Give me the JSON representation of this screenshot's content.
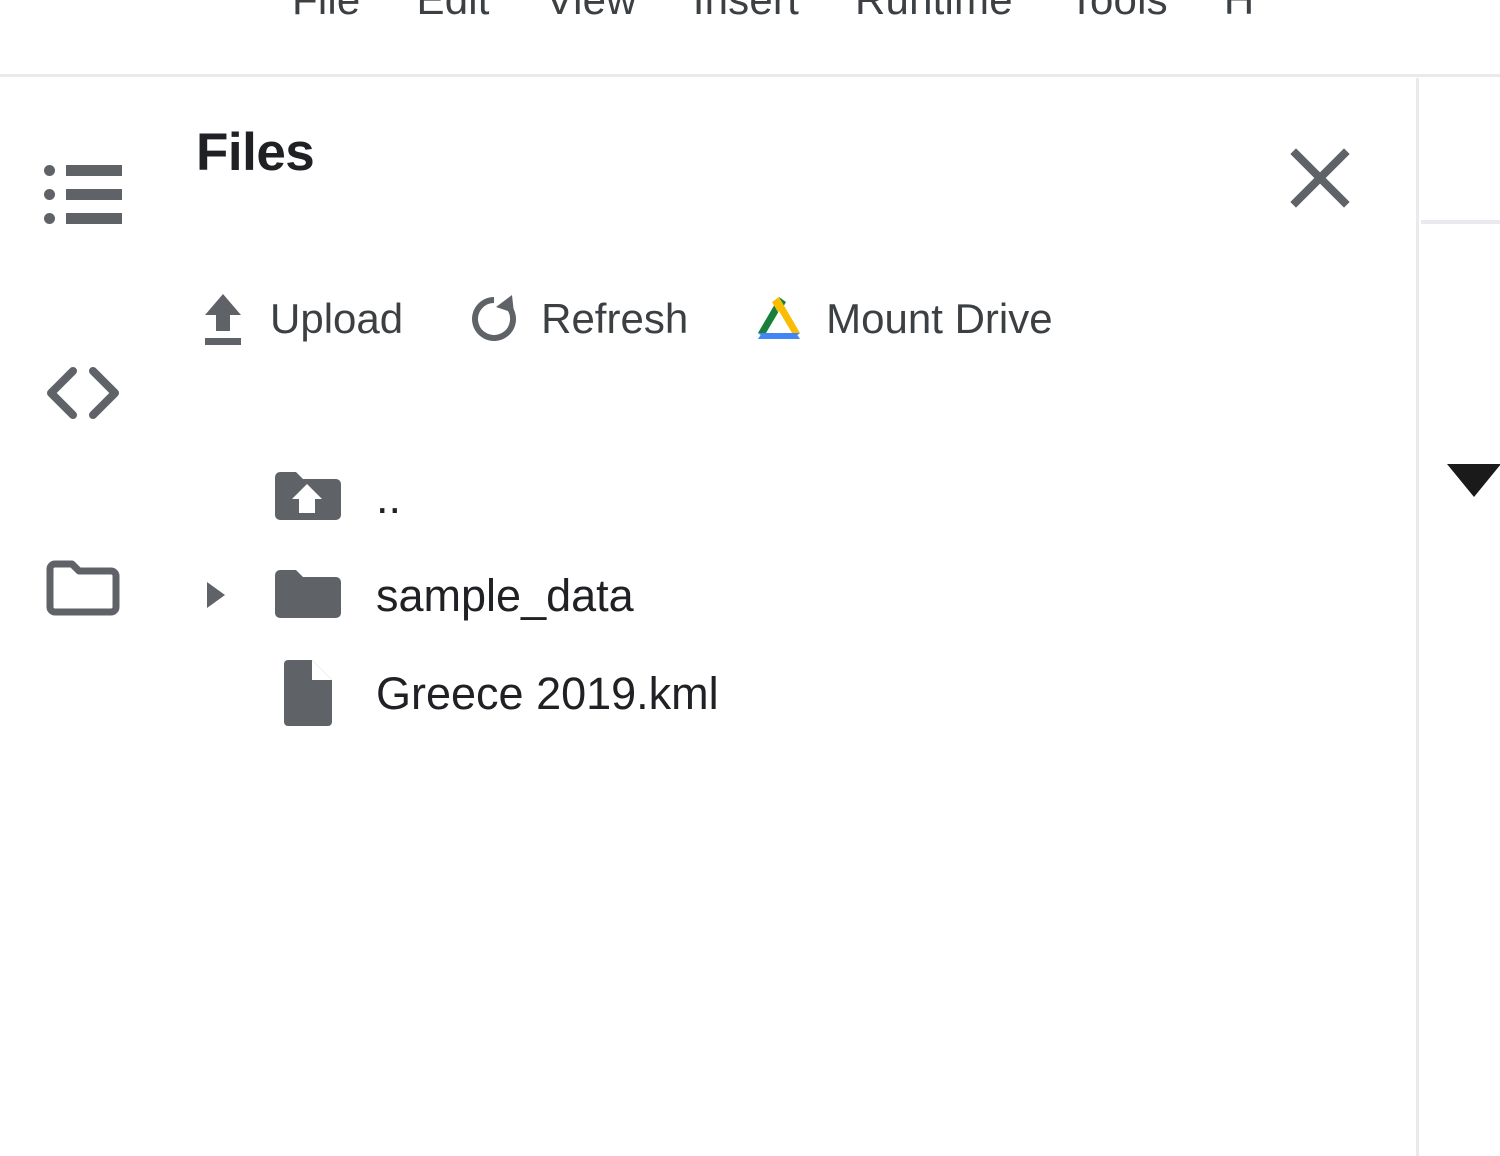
{
  "menubar": {
    "items": [
      {
        "label": "File"
      },
      {
        "label": "Edit"
      },
      {
        "label": "View"
      },
      {
        "label": "Insert"
      },
      {
        "label": "Runtime"
      },
      {
        "label": "Tools"
      },
      {
        "label": "H"
      }
    ]
  },
  "icon_rail": {
    "items": [
      {
        "name": "table-of-contents-icon",
        "icon": "list-icon"
      },
      {
        "name": "code-snippets-icon",
        "icon": "code-brackets-icon"
      },
      {
        "name": "files-icon",
        "icon": "folder-outline-icon"
      }
    ]
  },
  "panel": {
    "title": "Files",
    "close_icon": "close-icon"
  },
  "toolbar": {
    "buttons": [
      {
        "label": "Upload",
        "icon": "upload-icon"
      },
      {
        "label": "Refresh",
        "icon": "refresh-icon"
      },
      {
        "label": "Mount Drive",
        "icon": "google-drive-icon"
      }
    ]
  },
  "file_tree": {
    "rows": [
      {
        "label": "..",
        "icon": "parent-folder-icon",
        "expandable": false
      },
      {
        "label": "sample_data",
        "icon": "folder-icon",
        "expandable": true
      },
      {
        "label": "Greece 2019.kml",
        "icon": "file-icon",
        "expandable": false
      }
    ]
  },
  "right_strip": {
    "caret_icon": "caret-down-icon"
  },
  "colors": {
    "icon_gray": "#5f6368",
    "text_dark": "#202124",
    "text_menu": "#3c4043",
    "divider": "#e8eaed",
    "drive_green": "#188038",
    "drive_yellow": "#fbbc04",
    "drive_blue": "#4285f4"
  }
}
